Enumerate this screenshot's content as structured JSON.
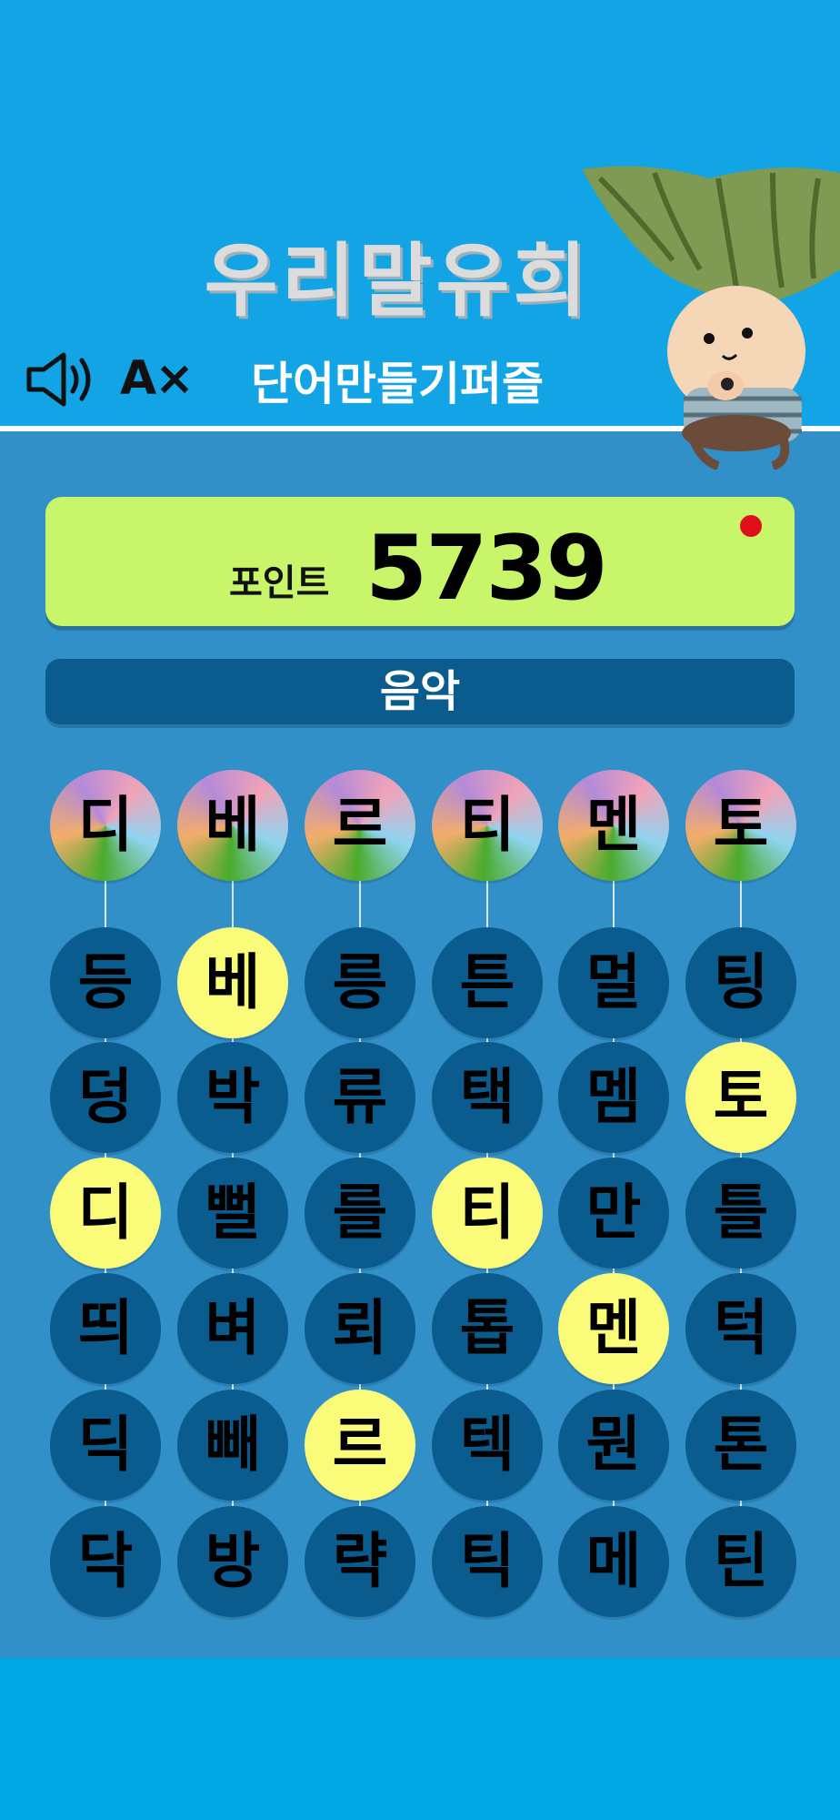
{
  "header": {
    "title": "우리말유희",
    "subtitle": "단어만들기퍼즐",
    "font_toggle": "A×"
  },
  "score": {
    "label": "포인트",
    "value": "5739"
  },
  "category": "음악",
  "answer": [
    "디",
    "베",
    "르",
    "티",
    "멘",
    "토"
  ],
  "grid": [
    [
      "등",
      "베",
      "릉",
      "튼",
      "멀",
      "팅"
    ],
    [
      "덩",
      "박",
      "류",
      "택",
      "멤",
      "토"
    ],
    [
      "디",
      "뻘",
      "를",
      "티",
      "만",
      "틀"
    ],
    [
      "띄",
      "벼",
      "뢰",
      "톱",
      "멘",
      "턱"
    ],
    [
      "딕",
      "빼",
      "르",
      "텍",
      "뭔",
      "톤"
    ],
    [
      "닥",
      "방",
      "략",
      "틱",
      "메",
      "틴"
    ]
  ],
  "selected": [
    [
      0,
      1
    ],
    [
      1,
      5
    ],
    [
      2,
      0
    ],
    [
      2,
      3
    ],
    [
      3,
      4
    ],
    [
      4,
      2
    ]
  ],
  "icons": {
    "sound": "speaker-icon",
    "mascot": "mascot-character-image",
    "alert": "red-dot-indicator"
  },
  "colors": {
    "header": "#12a4e4",
    "board": "#3290c8",
    "cell": "#0a5c8e",
    "selected": "#fbfb7a",
    "score_panel": "#c8f56a"
  }
}
